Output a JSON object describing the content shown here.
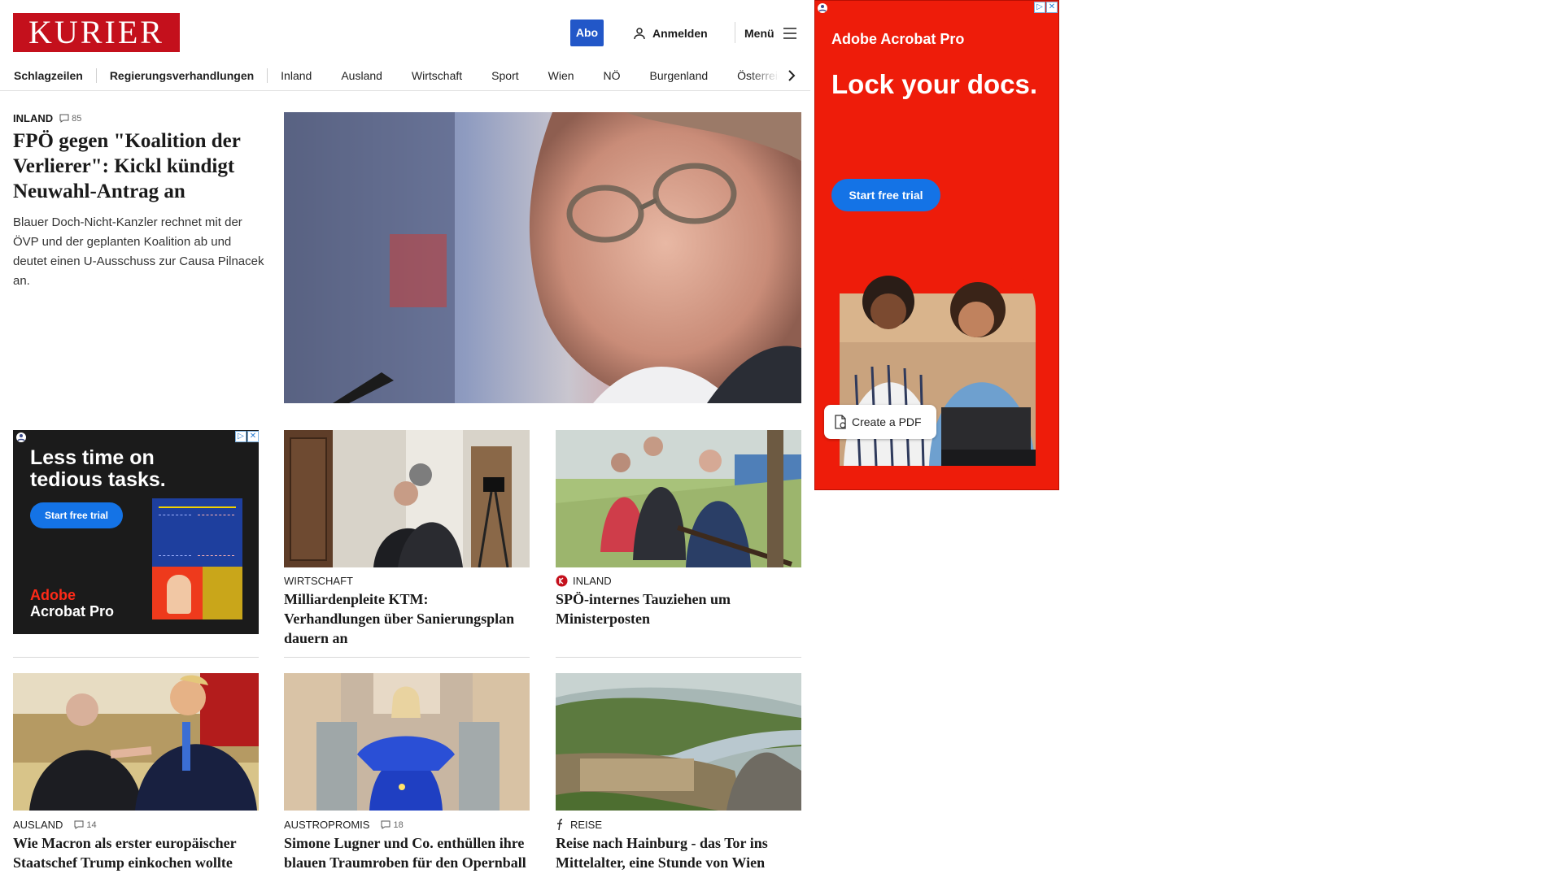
{
  "header": {
    "logo_text": "KURIER",
    "abo_label": "Abo",
    "login_label": "Anmelden",
    "menu_label": "Menü"
  },
  "nav": {
    "items": [
      "Schlagzeilen",
      "Regierungsverhandlungen",
      "Inland",
      "Ausland",
      "Wirtschaft",
      "Sport",
      "Wien",
      "NÖ",
      "Burgenland",
      "Österreich"
    ]
  },
  "hero": {
    "kicker": "INLAND",
    "comments": "85",
    "title": "FPÖ gegen \"Koalition der Verlierer\": Kickl kündigt Neuwahl-Antrag an",
    "teaser": "Blauer Doch-Nicht-Kanzler rechnet mit der ÖVP und der geplanten Koalition ab und deutet einen U-Ausschuss zur Causa Pilnacek an."
  },
  "cards": [
    {
      "kicker": "WIRTSCHAFT",
      "title": "Milliardenpleite KTM: Verhandlungen über Sanierungsplan dauern an"
    },
    {
      "kicker": "INLAND",
      "title": "SPÖ-internes Tauziehen um Ministerposten"
    },
    {
      "kicker": "AUSLAND",
      "comments": "14",
      "title": "Wie Macron als erster europäischer Staatschef Trump einkochen wollte"
    },
    {
      "kicker": "AUSTROPROMIS",
      "comments": "18",
      "title": "Simone Lugner und Co. enthüllen ihre blauen Traumroben für den Opernball"
    },
    {
      "kicker": "REISE",
      "title": "Reise nach Hainburg - das Tor ins Mittelalter, eine Stunde von Wien"
    }
  ],
  "ad_small": {
    "headline_1": "Less time on",
    "headline_2": "tedious tasks.",
    "cta": "Start free trial",
    "brand_1": "Adobe",
    "brand_2": "Acrobat Pro"
  },
  "ad_big": {
    "brand_1": "Adobe",
    "brand_2": "Acrobat Pro",
    "headline": "Lock your docs.",
    "cta": "Start free trial",
    "pdf_button": "Create a PDF"
  },
  "colors": {
    "brand_red": "#c4101c",
    "abo_blue": "#2257c8",
    "ad_red": "#ee1c0a",
    "ad_cta_blue": "#1473e6"
  }
}
